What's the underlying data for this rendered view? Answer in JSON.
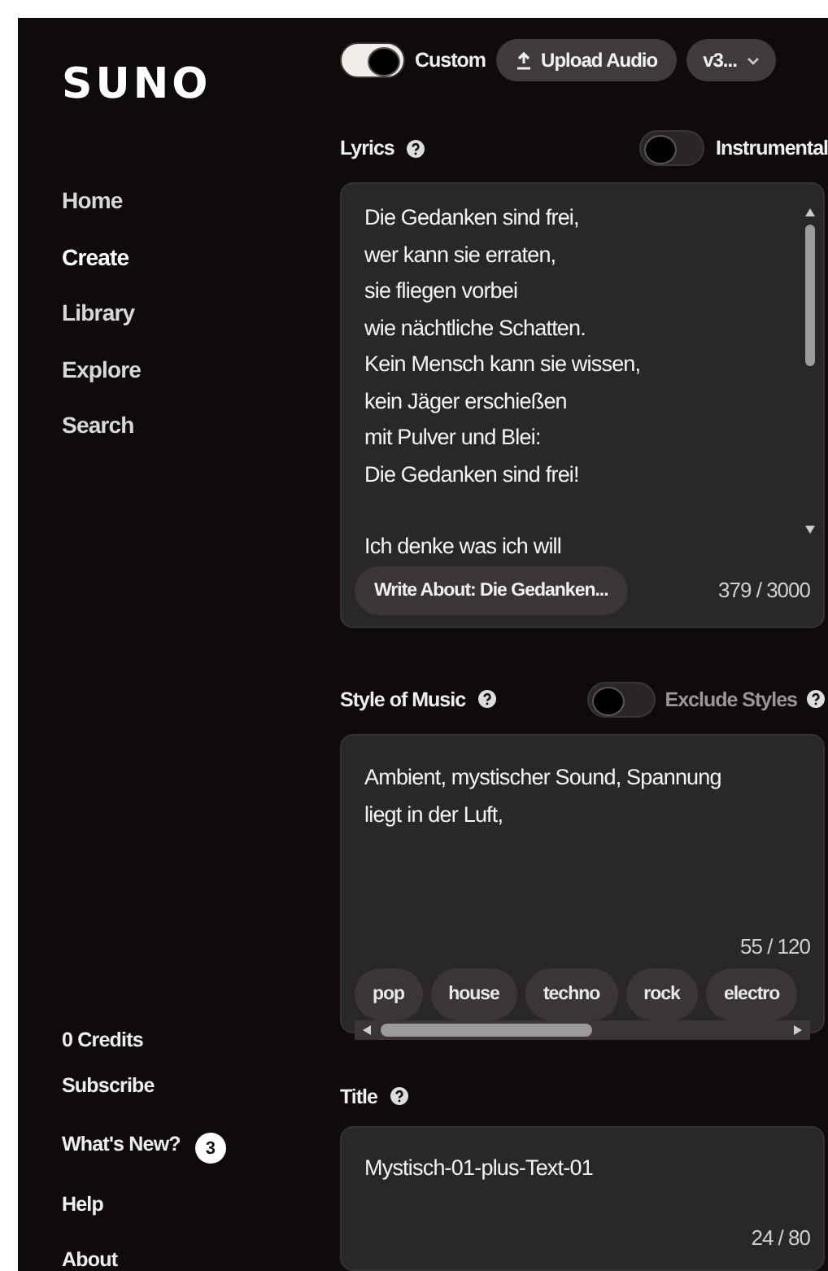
{
  "sidebar": {
    "logo": "SUNO",
    "nav": [
      {
        "label": "Home",
        "selected": false
      },
      {
        "label": "Create",
        "selected": true
      },
      {
        "label": "Library",
        "selected": false
      },
      {
        "label": "Explore",
        "selected": false
      },
      {
        "label": "Search",
        "selected": false
      }
    ],
    "credits": "0 Credits",
    "subscribe": "Subscribe",
    "whats_new": {
      "label": "What's New?",
      "badge": "3"
    },
    "help": "Help",
    "about": "About"
  },
  "top_bar": {
    "custom": {
      "label": "Custom",
      "on": true
    },
    "upload": "Upload Audio",
    "version": "v3..."
  },
  "lyrics": {
    "label": "Lyrics",
    "instrumental": {
      "label": "Instrumental",
      "on": false
    },
    "stanzas": [
      [
        "Die Gedanken sind frei,",
        "wer kann sie erraten,",
        "sie fliegen vorbei",
        "wie nächtliche Schatten.",
        "Kein Mensch kann sie wissen,",
        "kein Jäger erschießen",
        "mit Pulver und Blei:",
        "Die Gedanken sind frei!"
      ],
      [
        "Ich denke was ich will"
      ]
    ],
    "write_about": "Write About: Die Gedanken...",
    "count": "379 / 3000"
  },
  "style": {
    "label": "Style of Music",
    "exclude": {
      "label": "Exclude Styles",
      "on": false
    },
    "value": "Ambient, mystischer Sound, Spannung liegt in der Luft,",
    "count": "55 / 120",
    "tags": [
      "pop",
      "house",
      "techno",
      "rock",
      "electro"
    ]
  },
  "title": {
    "label": "Title",
    "value": "Mystisch-01-plus-Text-01",
    "count": "24 / 80"
  }
}
